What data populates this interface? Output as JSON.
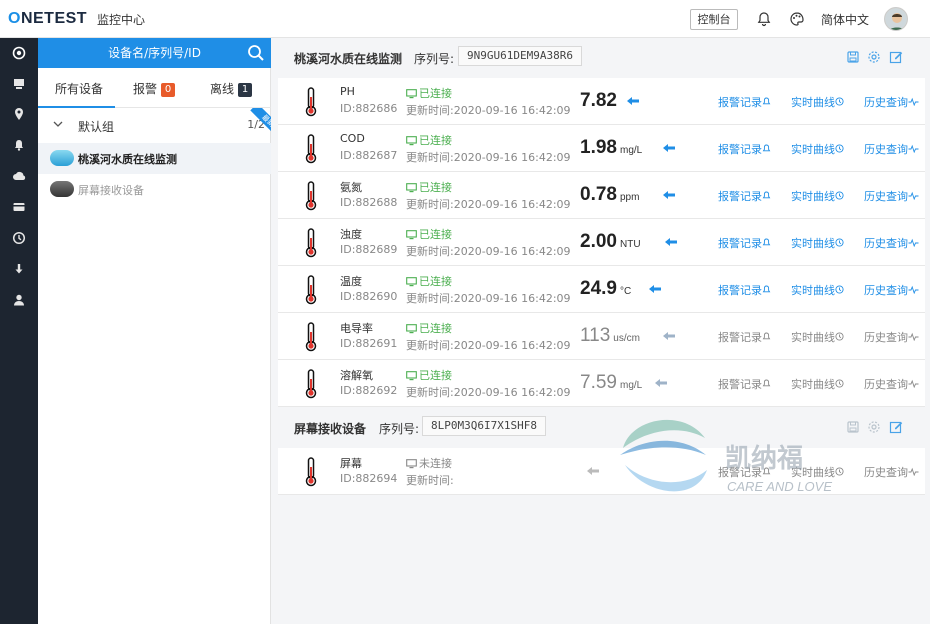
{
  "app": {
    "logo_prefix": "O",
    "logo_rest": "NETEST",
    "nav_title": "监控中心",
    "console_label": "控制台",
    "language": "简体中文"
  },
  "icons": {
    "bell": "bell-icon",
    "palette": "palette-icon",
    "search": "search-icon"
  },
  "colors": {
    "brand": "#1f8ee6",
    "rail": "#1d2530",
    "connected": "#4caf50",
    "alarm_badge": "#e85b2a"
  },
  "sidebar": {
    "search_placeholder": "设备名/序列号/ID",
    "tabs": [
      {
        "label": "所有设备"
      },
      {
        "label": "报警",
        "count": "0"
      },
      {
        "label": "离线",
        "count": "1"
      }
    ],
    "group": {
      "name": "默认组",
      "count": "1/2",
      "ribbon": "最新"
    },
    "devices": [
      {
        "name": "桃溪河水质在线监测"
      },
      {
        "name": "屏幕接收设备"
      }
    ]
  },
  "devices": [
    {
      "name": "桃溪河水质在线监测",
      "serial_label": "序列号:",
      "serial": "9N9GU61DEM9A38R6",
      "sensors": [
        {
          "name": "PH",
          "id": "ID:882686",
          "status": "已连接",
          "time": "更新时间:2020-09-16 16:42:09",
          "value": "7.82",
          "unit": ""
        },
        {
          "name": "COD",
          "id": "ID:882687",
          "status": "已连接",
          "time": "更新时间:2020-09-16 16:42:09",
          "value": "1.98",
          "unit": "mg/L"
        },
        {
          "name": "氨氮",
          "id": "ID:882688",
          "status": "已连接",
          "time": "更新时间:2020-09-16 16:42:09",
          "value": "0.78",
          "unit": "ppm"
        },
        {
          "name": "浊度",
          "id": "ID:882689",
          "status": "已连接",
          "time": "更新时间:2020-09-16 16:42:09",
          "value": "2.00",
          "unit": "NTU"
        },
        {
          "name": "温度",
          "id": "ID:882690",
          "status": "已连接",
          "time": "更新时间:2020-09-16 16:42:09",
          "value": "24.9",
          "unit": "°C"
        },
        {
          "name": "电导率",
          "id": "ID:882691",
          "status": "已连接",
          "time": "更新时间:2020-09-16 16:42:09",
          "value": "113",
          "unit": "us/cm"
        },
        {
          "name": "溶解氧",
          "id": "ID:882692",
          "status": "已连接",
          "time": "更新时间:2020-09-16 16:42:09",
          "value": "7.59",
          "unit": "mg/L"
        }
      ]
    },
    {
      "name": "屏幕接收设备",
      "serial_label": "序列号:",
      "serial": "8LP0M3Q6I7X1SHF8",
      "sensors": [
        {
          "name": "屏幕",
          "id": "ID:882694",
          "status": "未连接",
          "time": "更新时间:",
          "value": "",
          "unit": ""
        }
      ]
    }
  ],
  "row_links": {
    "alarm": "报警记录",
    "realtime": "实时曲线",
    "history": "历史查询"
  },
  "watermark": {
    "brand": "凯纳福",
    "slogan": "CARE AND LOVE"
  }
}
